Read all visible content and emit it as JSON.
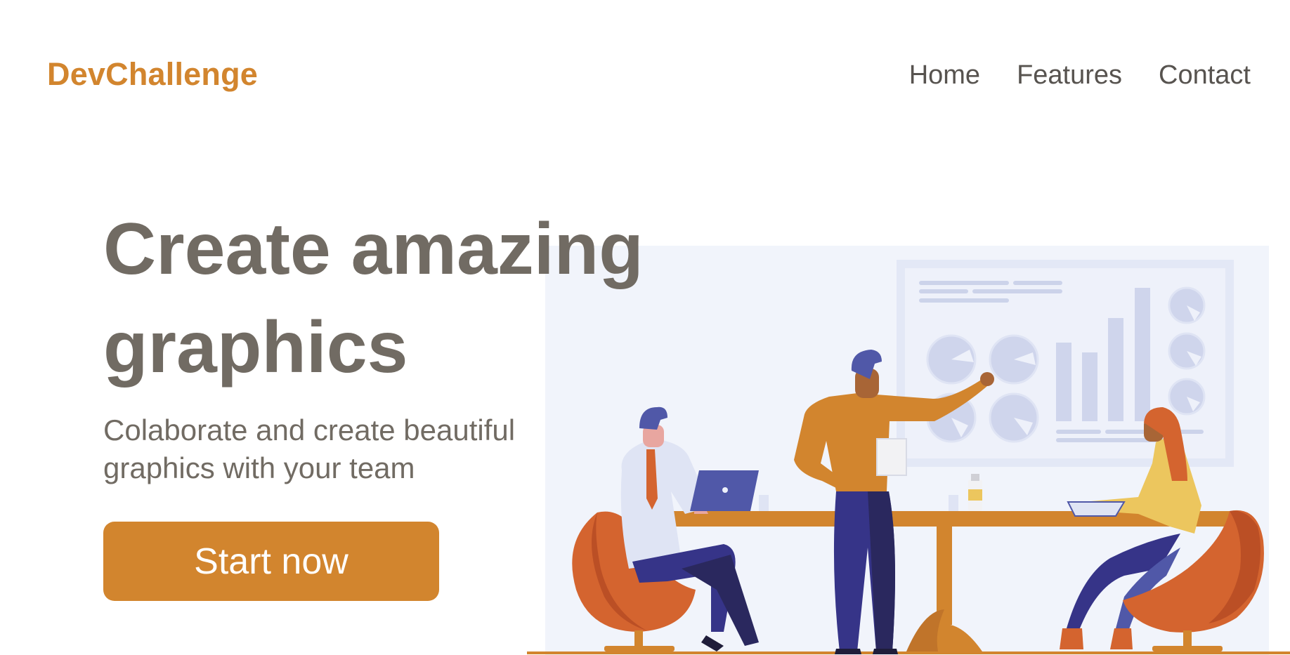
{
  "header": {
    "logo": "DevChallenge",
    "nav": [
      "Home",
      "Features",
      "Contact"
    ]
  },
  "hero": {
    "title": "Create amazing graphics",
    "subtitle": "Colaborate and create beautiful graphics with your team",
    "cta_label": "Start now"
  },
  "illustration": {
    "subject": "team-meeting-illustration"
  },
  "colors": {
    "accent": "#d2852e",
    "heading_text": "#716b63",
    "nav_text": "#57534f",
    "illustration_bg": "#f1f4fb",
    "navy": "#363488",
    "chair_orange": "#d4642f"
  }
}
